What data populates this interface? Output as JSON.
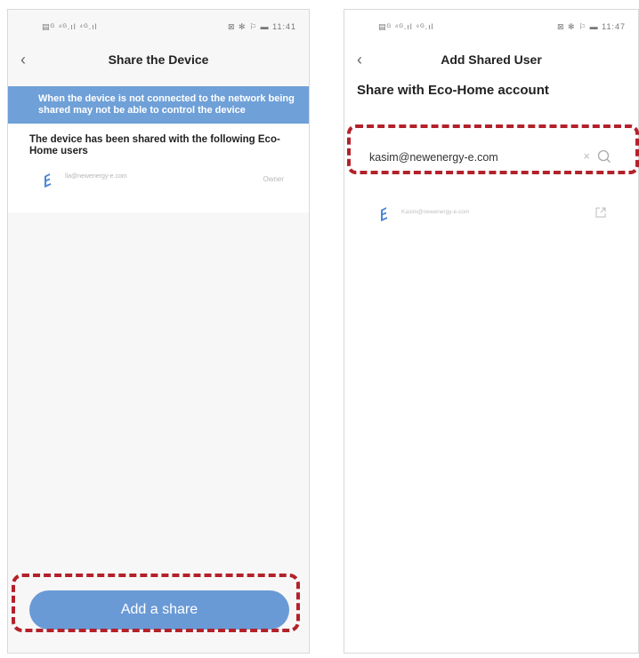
{
  "left": {
    "status": {
      "left": "▤ᴳ ⁴ᴳ.ıl ⁴ᴳ.ıl",
      "right": "⊠ ✻ ⚐ ▬ 11:41"
    },
    "title": "Share the Device",
    "banner": "When the device is not connected to the network being shared may not be able to control the device",
    "shared_heading": "The device has been shared with the following Eco-Home users",
    "shared_user": {
      "email": "lla@newenergy-e.com",
      "role": "Owner"
    },
    "add_button": "Add a share"
  },
  "right": {
    "status": {
      "left": "▤ᴳ ⁴ᴳ.ıl ⁴ᴳ.ıl",
      "right": "⊠ ✻ ⚐ ▬ 11:47"
    },
    "title": "Add Shared User",
    "heading": "Share with Eco-Home account",
    "search_value": "kasim@newenergy-e.com",
    "result_email": "Kasim@newenergy-e.com"
  },
  "colors": {
    "accent": "#6a9ad6",
    "banner": "#6fa0d8",
    "highlight": "#b3212a"
  }
}
